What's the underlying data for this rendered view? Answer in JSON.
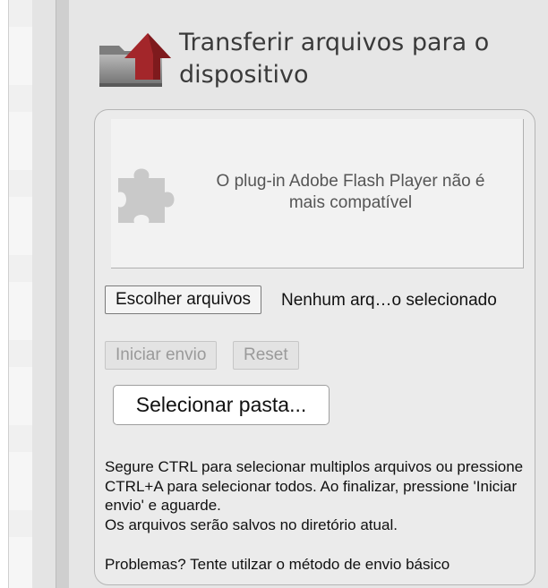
{
  "panel": {
    "title": "Transferir arquivos para o dispositivo",
    "header_icon": "folder-upload-icon"
  },
  "flash_notice": {
    "icon": "puzzle-plugin-icon",
    "message": "O plug-in Adobe Flash Player não é mais compatível"
  },
  "file_picker": {
    "button_label": "Escolher arquivos",
    "status": "Nenhum arq…o selecionado"
  },
  "actions": {
    "start_label": "Iniciar envio",
    "reset_label": "Reset",
    "select_folder_label": "Selecionar pasta..."
  },
  "help": {
    "line1": "Segure CTRL para selecionar multiplos arquivos ou pressione CTRL+A para selecionar todos. Ao finalizar, pressione 'Iniciar envio' e aguarde.",
    "line2": "Os arquivos serão salvos no diretório atual.",
    "problems": "Problemas? Tente utilzar o método de envio básico"
  },
  "colors": {
    "panel_bg": "#e6e6e6",
    "upload_arrow": "#a3262a",
    "folder_gray": "#8c8c8c"
  }
}
